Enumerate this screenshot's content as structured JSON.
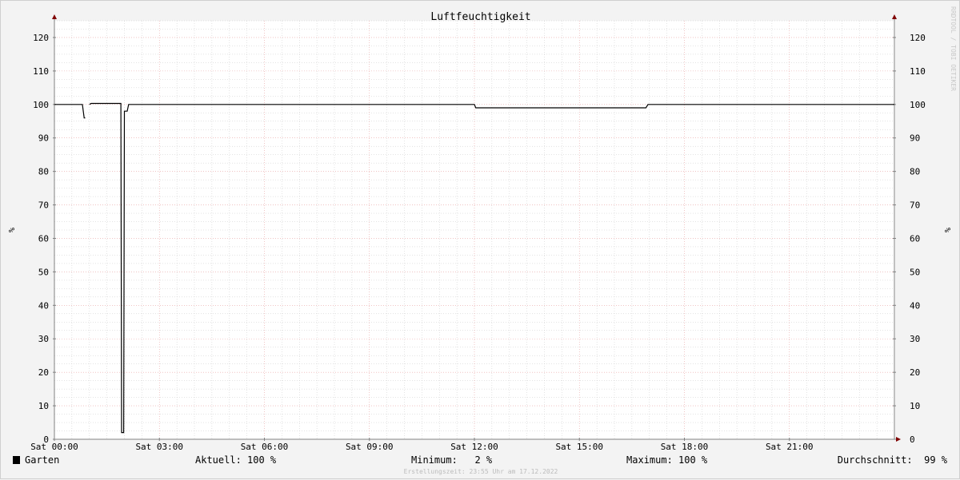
{
  "chart_data": {
    "type": "line",
    "title": "Luftfeuchtigkeit",
    "ylabel": "%",
    "ylim": [
      0,
      125
    ],
    "yticks": [
      0,
      10,
      20,
      30,
      40,
      50,
      60,
      70,
      80,
      90,
      100,
      110,
      120
    ],
    "xlim_hours": [
      0,
      24
    ],
    "xticks": [
      {
        "hour": 0,
        "label": "Sat 00:00"
      },
      {
        "hour": 3,
        "label": "Sat 03:00"
      },
      {
        "hour": 6,
        "label": "Sat 06:00"
      },
      {
        "hour": 9,
        "label": "Sat 09:00"
      },
      {
        "hour": 12,
        "label": "Sat 12:00"
      },
      {
        "hour": 15,
        "label": "Sat 15:00"
      },
      {
        "hour": 18,
        "label": "Sat 18:00"
      },
      {
        "hour": 21,
        "label": "Sat 21:00"
      }
    ],
    "grid": true,
    "series": [
      {
        "name": "Garten",
        "color": "#000000",
        "segments": [
          [
            [
              0.0,
              100
            ],
            [
              0.8,
              100
            ],
            [
              0.85,
              96
            ],
            [
              0.88,
              96
            ]
          ],
          [
            [
              1.0,
              100
            ],
            [
              1.05,
              100.3
            ],
            [
              1.9,
              100.3
            ],
            [
              1.92,
              2
            ],
            [
              1.98,
              2
            ],
            [
              2.0,
              98
            ],
            [
              2.08,
              98
            ],
            [
              2.12,
              100
            ],
            [
              12.0,
              100
            ],
            [
              12.04,
              99
            ],
            [
              16.9,
              99
            ],
            [
              16.96,
              100
            ],
            [
              24.0,
              100
            ]
          ]
        ]
      }
    ]
  },
  "legend": {
    "series_name": "Garten",
    "aktuell_label": "Aktuell:",
    "aktuell_value": "100 %",
    "minimum_label": "Minimum:",
    "minimum_value": "2 %",
    "maximum_label": "Maximum:",
    "maximum_value": "100 %",
    "durchschnitt_label": "Durchschnitt:",
    "durchschnitt_value": "99 %"
  },
  "footer": "Erstellungszeit: 23:55 Uhr am 17.12.2022",
  "watermark": "RRDTOOL / TOBI OETIKER",
  "colors": {
    "major_grid": "#e8a0a0",
    "minor_grid": "#c8c8c8",
    "axis": "#808080",
    "arrow": "#800000",
    "plot_bg": "#ffffff"
  }
}
